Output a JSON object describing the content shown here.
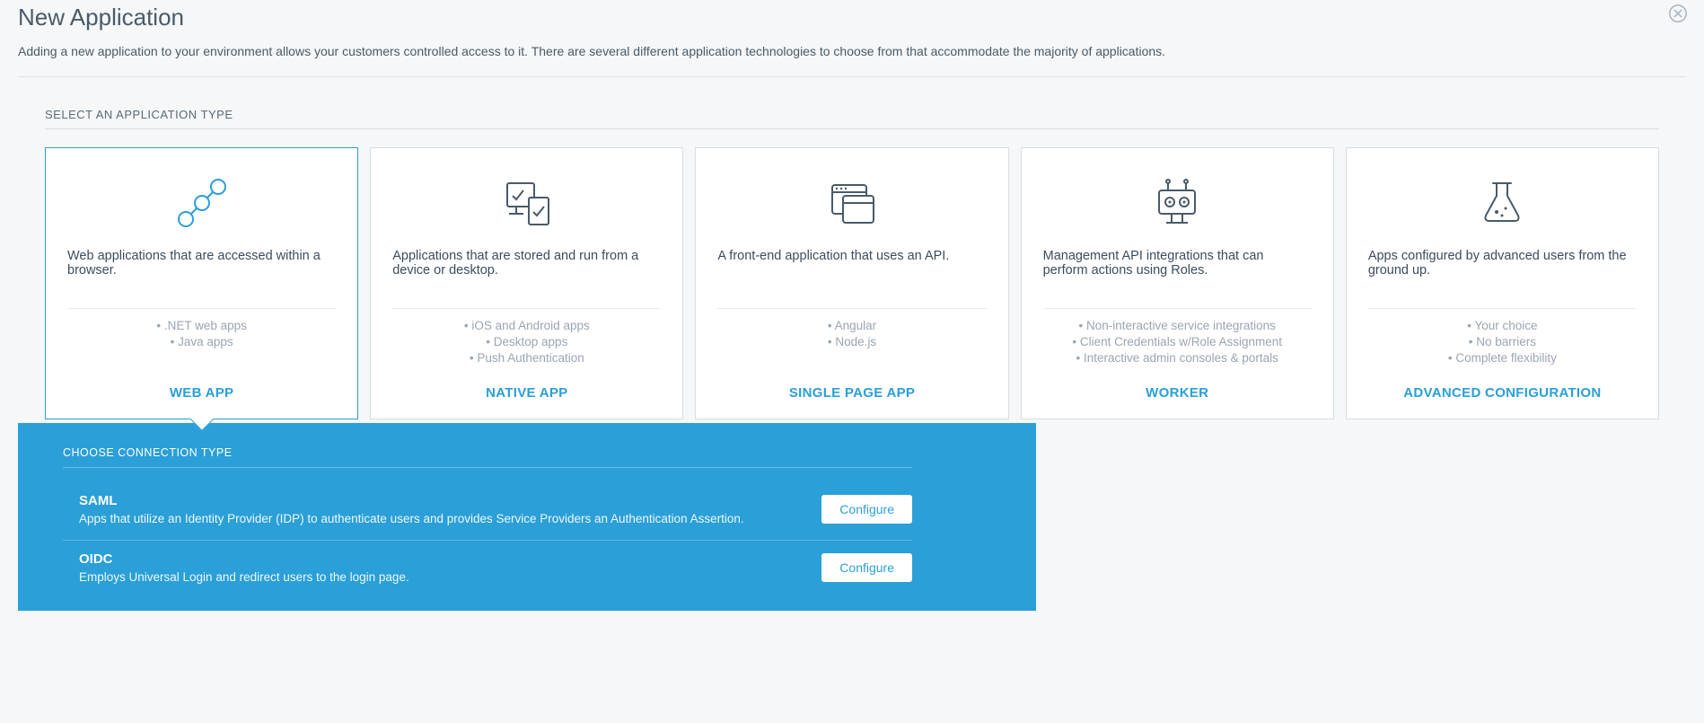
{
  "header": {
    "title": "New Application",
    "description": "Adding a new application to your environment allows your customers controlled access to it. There are several different application technologies to choose from that accommodate the majority of applications."
  },
  "section_label": "SELECT AN APPLICATION TYPE",
  "app_types": [
    {
      "desc": "Web applications that are accessed within a browser.",
      "examples": [
        ".NET web apps",
        "Java apps"
      ],
      "label": "WEB APP",
      "selected": true
    },
    {
      "desc": "Applications that are stored and run from a device or desktop.",
      "examples": [
        "iOS and Android apps",
        "Desktop apps",
        "Push Authentication"
      ],
      "label": "NATIVE APP",
      "selected": false
    },
    {
      "desc": "A front-end application that uses an API.",
      "examples": [
        "Angular",
        "Node.js"
      ],
      "label": "SINGLE PAGE APP",
      "selected": false
    },
    {
      "desc": "Management API integrations that can perform actions using Roles.",
      "examples": [
        "Non-interactive service integrations",
        "Client Credentials w/Role Assignment",
        "Interactive admin consoles & portals"
      ],
      "label": "WORKER",
      "selected": false
    },
    {
      "desc": "Apps configured by advanced users from the ground up.",
      "examples": [
        "Your choice",
        "No barriers",
        "Complete flexibility"
      ],
      "label": "ADVANCED CONFIGURATION",
      "selected": false
    }
  ],
  "connection": {
    "label": "CHOOSE CONNECTION TYPE",
    "options": [
      {
        "name": "SAML",
        "desc": "Apps that utilize an Identity Provider (IDP) to authenticate users and provides Service Providers an Authentication Assertion.",
        "button": "Configure"
      },
      {
        "name": "OIDC",
        "desc": "Employs Universal Login and redirect users to the login page.",
        "button": "Configure"
      }
    ]
  }
}
